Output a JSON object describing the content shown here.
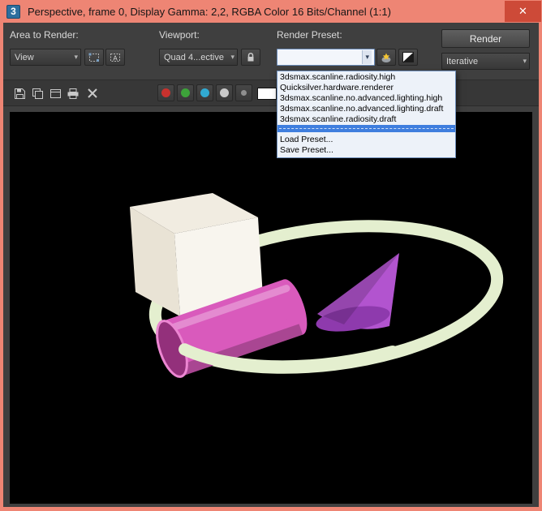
{
  "window": {
    "title": "Perspective, frame 0, Display Gamma: 2,2, RGBA Color 16 Bits/Channel (1:1)",
    "app_icon_text": "3",
    "close_glyph": "✕"
  },
  "icons": {
    "chevron_down": "▾"
  },
  "toolbar": {
    "area_label": "Area to Render:",
    "area_value": "View",
    "viewport_label": "Viewport:",
    "viewport_value": "Quad 4...ective",
    "preset_label": "Render Preset:",
    "preset_value": "",
    "render_button": "Render",
    "mode_value": "Iterative",
    "auto_region_letter": "A"
  },
  "preset_dropdown": {
    "items": [
      "3dsmax.scanline.radiosity.high",
      "Quicksilver.hardware.renderer",
      "3dsmax.scanline.no.advanced.lighting.high",
      "3dsmax.scanline.no.advanced.lighting.draft",
      "3dsmax.scanline.radiosity.draft"
    ],
    "load_item": "Load Preset...",
    "save_item": "Save Preset...",
    "highlight_color": "#3f7ede"
  },
  "channels": {
    "red": "#c9322e",
    "green": "#3da33a",
    "blue": "#31aad2",
    "mono": "#c9c9c9",
    "alpha": "#8f8f8f",
    "swatch": "#ffffff"
  },
  "scene": {
    "background": "#000000",
    "torus": "#e4efcf",
    "box_top": "#f1ece1",
    "box_left": "#e9e3d5",
    "box_front": "#f8f5ee",
    "cylinder": "#d95abc",
    "cylinder_inner": "#93307b",
    "cylinder_rim": "#ec86d2",
    "cone": "#b254cf",
    "cone_base": "#8e3aad"
  }
}
